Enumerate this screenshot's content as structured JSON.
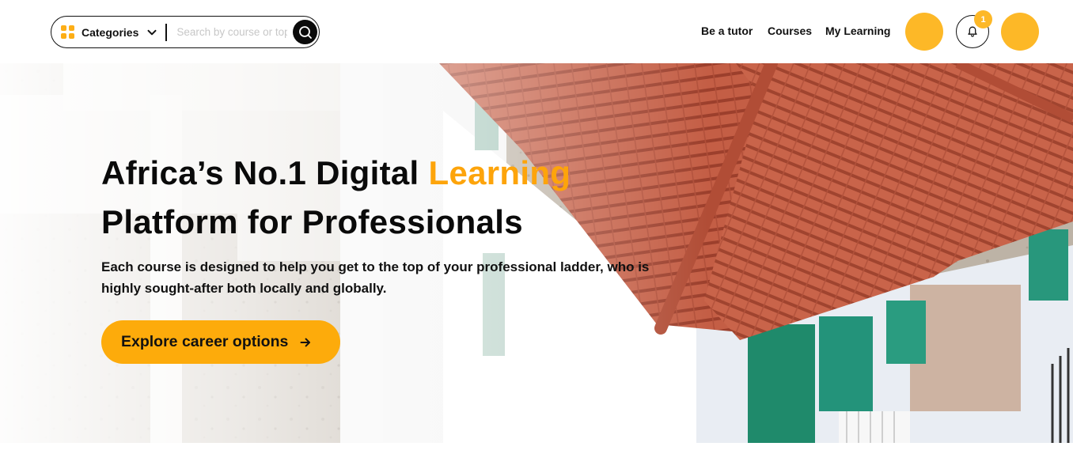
{
  "header": {
    "categories_label": "Categories",
    "search_placeholder": "Search by course or topic",
    "nav": {
      "be_a_tutor": "Be a tutor",
      "courses": "Courses",
      "my_learning": "My Learning"
    },
    "notification_count": "1",
    "icons": [
      "grid-icon",
      "chevron-down-icon",
      "search-icon",
      "bell-icon"
    ]
  },
  "hero": {
    "title_part1": "Africa’s No.1 Digital ",
    "title_accent": "Learning",
    "title_part2": "Platform for Professionals",
    "subtitle": "Each course is designed to help you get to the top of your professional ladder, who is highly sought-after both locally and globally.",
    "cta_label": "Explore career options",
    "cta_icon": "arrow-right-icon"
  },
  "colors": {
    "accent": "#FDAB0B",
    "avatar_yellow": "#FDB827",
    "text": "#111111"
  }
}
